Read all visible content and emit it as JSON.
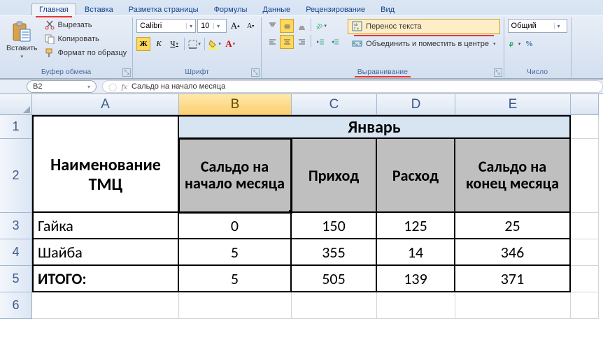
{
  "tabs": [
    "Главная",
    "Вставка",
    "Разметка страницы",
    "Формулы",
    "Данные",
    "Рецензирование",
    "Вид"
  ],
  "clipboard": {
    "paste": "Вставить",
    "cut": "Вырезать",
    "copy": "Копировать",
    "fmt": "Формат по образцу",
    "title": "Буфер обмена"
  },
  "font": {
    "name": "Calibri",
    "size": "10",
    "title": "Шрифт",
    "bold": "Ж",
    "italic": "К",
    "underline": "Ч"
  },
  "align": {
    "wrap": "Перенос текста",
    "merge": "Объединить и поместить в центре",
    "title": "Выравнивание"
  },
  "number": {
    "general": "Общий",
    "title": "Число"
  },
  "namebox": "B2",
  "formula": "Сальдо на начало месяца",
  "colLetters": [
    "A",
    "B",
    "C",
    "D",
    "E"
  ],
  "rowNums": [
    "1",
    "2",
    "3",
    "4",
    "5",
    "6"
  ],
  "table": {
    "month": "Январь",
    "nameHdr": "Наименование ТМЦ",
    "colHdrs": [
      "Сальдо на начало месяца",
      "Приход",
      "Расход",
      "Сальдо на конец месяца"
    ],
    "rows": [
      {
        "name": "Гайка",
        "v": [
          "0",
          "150",
          "125",
          "25"
        ]
      },
      {
        "name": "Шайба",
        "v": [
          "5",
          "355",
          "14",
          "346"
        ]
      },
      {
        "name": "ИТОГО:",
        "v": [
          "5",
          "505",
          "139",
          "371"
        ],
        "bold": true
      }
    ]
  }
}
